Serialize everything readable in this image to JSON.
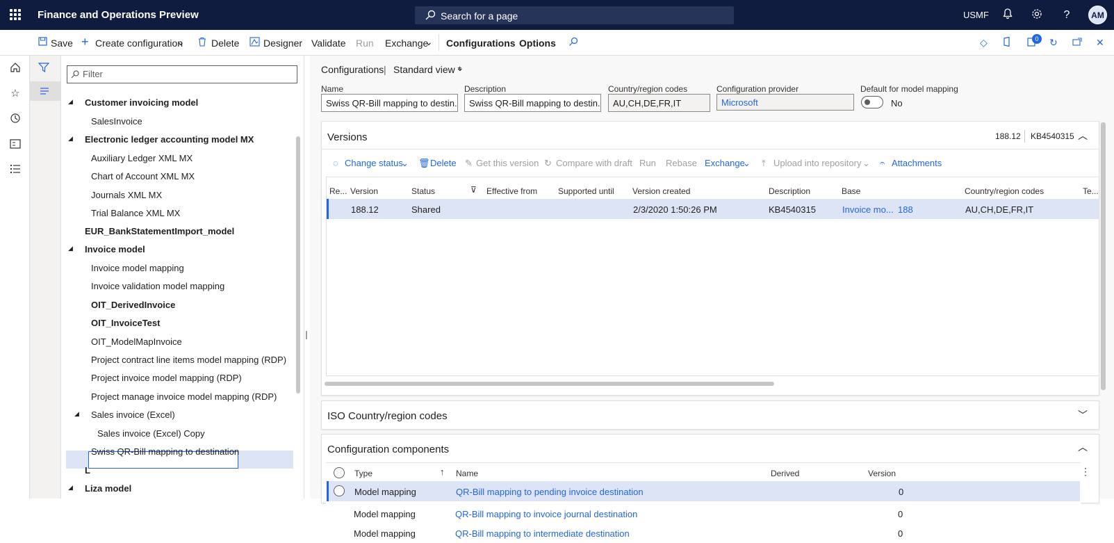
{
  "app": {
    "title": "Finance and Operations Preview",
    "company": "USMF",
    "avatar": "AM",
    "notification_count": "0"
  },
  "search": {
    "placeholder": "Search for a page"
  },
  "actions": {
    "save": "Save",
    "create_configuration": "Create configuration",
    "delete": "Delete",
    "designer": "Designer",
    "validate": "Validate",
    "run": "Run",
    "exchange": "Exchange",
    "configurations": "Configurations",
    "options": "Options"
  },
  "filter": {
    "placeholder": "Filter"
  },
  "tree": {
    "items": [
      {
        "label": "Customer invoicing model",
        "bold": true
      },
      {
        "label": "SalesInvoice",
        "bold": false
      },
      {
        "label": "Electronic ledger accounting model MX",
        "bold": true
      },
      {
        "label": "Auxiliary Ledger XML MX",
        "bold": false
      },
      {
        "label": "Chart of Account XML MX",
        "bold": false
      },
      {
        "label": "Journals XML MX",
        "bold": false
      },
      {
        "label": "Trial Balance XML MX",
        "bold": false
      },
      {
        "label": "EUR_BankStatementImport_model",
        "bold": true
      },
      {
        "label": "Invoice model",
        "bold": true
      },
      {
        "label": "Invoice model mapping",
        "bold": false
      },
      {
        "label": "Invoice validation model mapping",
        "bold": false
      },
      {
        "label": "OIT_DerivedInvoice",
        "bold": true
      },
      {
        "label": "OIT_InvoiceTest",
        "bold": true
      },
      {
        "label": "OIT_ModelMapInvoice",
        "bold": false
      },
      {
        "label": "Project contract line items model mapping (RDP)",
        "bold": false
      },
      {
        "label": "Project invoice model mapping (RDP)",
        "bold": false
      },
      {
        "label": "Project manage invoice model mapping (RDP)",
        "bold": false
      },
      {
        "label": "Sales invoice (Excel)",
        "bold": false
      },
      {
        "label": "Sales invoice (Excel) Copy",
        "bold": false
      },
      {
        "label": "Swiss QR-Bill mapping to destination",
        "bold": false
      },
      {
        "label": "L",
        "bold": true
      },
      {
        "label": "Liza model",
        "bold": true
      }
    ]
  },
  "breadcrumb": {
    "root": "Configurations",
    "separator": "|",
    "view": "Standard view *"
  },
  "header": {
    "name_label": "Name",
    "name_value": "Swiss QR-Bill mapping to destin...",
    "description_label": "Description",
    "description_value": "Swiss QR-Bill mapping to destin...",
    "country_label": "Country/region codes",
    "country_value": "AU,CH,DE,FR,IT",
    "provider_label": "Configuration provider",
    "provider_value": "Microsoft",
    "default_label": "Default for model mapping",
    "default_value": "No"
  },
  "versions": {
    "title": "Versions",
    "summary_version": "188.12",
    "summary_desc": "KB4540315",
    "actions": {
      "change_status": "Change status",
      "delete": "Delete",
      "get_version": "Get this version",
      "compare": "Compare with draft",
      "run": "Run",
      "rebase": "Rebase",
      "exchange": "Exchange",
      "upload": "Upload into repository",
      "attachments": "Attachments"
    },
    "columns": [
      "Re...",
      "Version",
      "Status",
      "Effective from",
      "Supported until",
      "Version created",
      "Description",
      "Base",
      "Country/region codes",
      "Te..."
    ],
    "rows": [
      {
        "version": "188.12",
        "status": "Shared",
        "created": "2/3/2020 1:50:26 PM",
        "description": "KB4540315",
        "base": "Invoice mo...",
        "base_version": "188",
        "country": "AU,CH,DE,FR,IT"
      }
    ]
  },
  "iso": {
    "title": "ISO Country/region codes"
  },
  "components": {
    "title": "Configuration components",
    "columns": {
      "type": "Type",
      "name": "Name",
      "derived": "Derived",
      "version": "Version"
    },
    "rows": [
      {
        "type": "Model mapping",
        "name": "QR-Bill mapping to pending invoice destination",
        "version": "0"
      },
      {
        "type": "Model mapping",
        "name": "QR-Bill mapping to invoice journal destination",
        "version": "0"
      },
      {
        "type": "Model mapping",
        "name": "QR-Bill mapping to intermediate destination",
        "version": "0"
      }
    ]
  },
  "colors": {
    "topbar": "#0f1c3f",
    "accent": "#2266e3",
    "selection": "#dde4f5"
  }
}
